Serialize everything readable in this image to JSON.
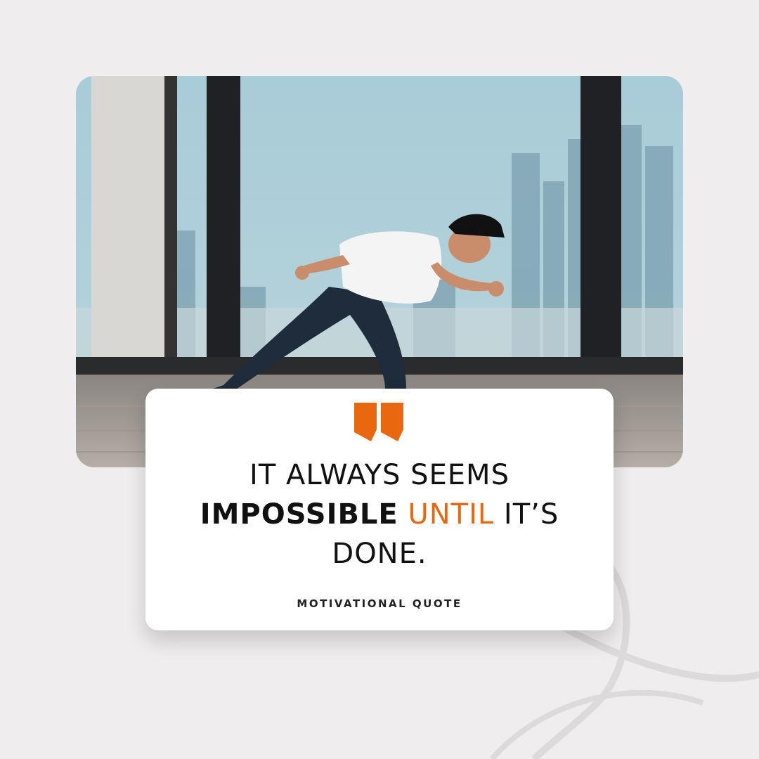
{
  "quote": {
    "line1": "It always seems",
    "bold_word": "impossible",
    "accent_word": "until",
    "rest": "it’s done."
  },
  "caption": "MOTIVATIONAL QUOTE",
  "colors": {
    "accent": "#e8670f",
    "background": "#efedee",
    "card": "#ffffff",
    "text": "#111111"
  },
  "icons": {
    "quote": "quote-mark-icon"
  },
  "photo": {
    "subject": "runner-sprinting-city-skyline"
  }
}
